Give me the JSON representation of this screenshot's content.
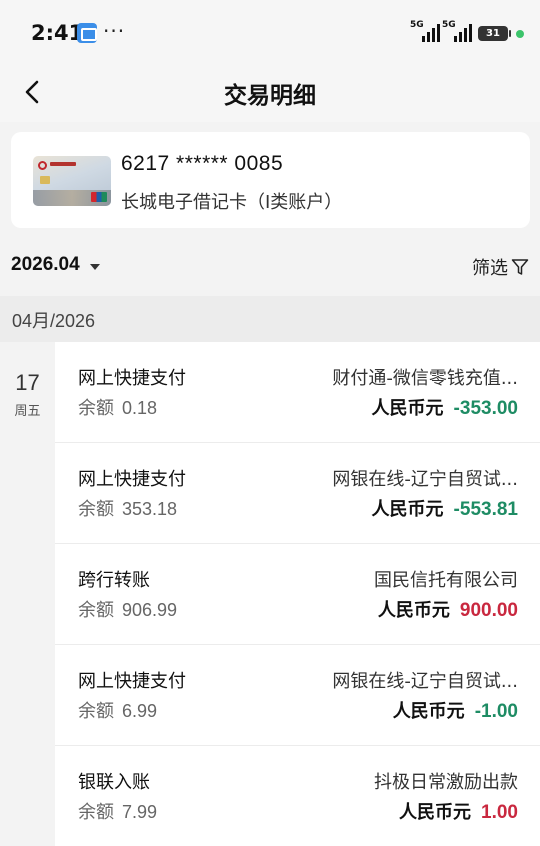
{
  "status_bar": {
    "time": "2:41",
    "signal_1": "5G",
    "signal_2": "5G",
    "battery": "31"
  },
  "nav": {
    "title": "交易明细"
  },
  "account": {
    "card_number": "6217 ****** 0085",
    "card_type": "长城电子借记卡（I类账户）"
  },
  "filter": {
    "month": "2026.04",
    "label": "筛选"
  },
  "section": {
    "label": "04月/2026"
  },
  "date": {
    "day": "17",
    "weekday": "周五"
  },
  "balance_label": "余额",
  "transactions": [
    {
      "type": "网上快捷支付",
      "balance": "0.18",
      "counterparty": "财付通-微信零钱充值...",
      "currency": "人民币元",
      "amount": "-353.00",
      "direction": "out"
    },
    {
      "type": "网上快捷支付",
      "balance": "353.18",
      "counterparty": "网银在线-辽宁自贸试...",
      "currency": "人民币元",
      "amount": "-553.81",
      "direction": "out"
    },
    {
      "type": "跨行转账",
      "balance": "906.99",
      "counterparty": "国民信托有限公司",
      "currency": "人民币元",
      "amount": "900.00",
      "direction": "in"
    },
    {
      "type": "网上快捷支付",
      "balance": "6.99",
      "counterparty": "网银在线-辽宁自贸试...",
      "currency": "人民币元",
      "amount": "-1.00",
      "direction": "out"
    },
    {
      "type": "银联入账",
      "balance": "7.99",
      "counterparty": "抖极日常激励出款",
      "currency": "人民币元",
      "amount": "1.00",
      "direction": "in"
    }
  ],
  "colors": {
    "outgoing": "#1e8c64",
    "incoming": "#c9283f"
  }
}
